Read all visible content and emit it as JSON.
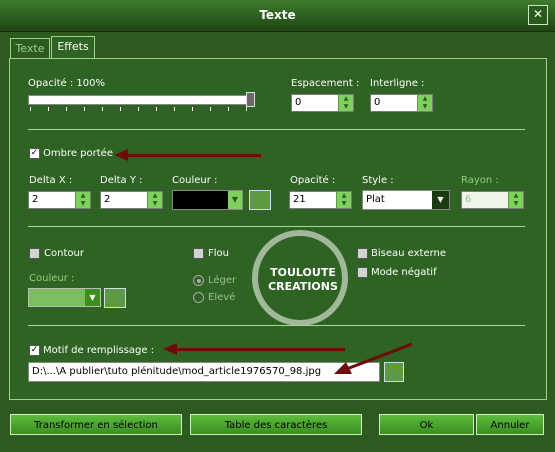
{
  "window": {
    "title": "Texte",
    "close_icon": "close-icon"
  },
  "tabs": [
    {
      "label": "Texte"
    },
    {
      "label": "Effets"
    }
  ],
  "opacity": {
    "label": "Opacité : 100%",
    "value_percent": 100
  },
  "espacement": {
    "label": "Espacement :",
    "value": "0"
  },
  "interligne": {
    "label": "Interligne :",
    "value": "0"
  },
  "ombre": {
    "label": "Ombre portée",
    "checked": true
  },
  "delta_x": {
    "label": "Delta X :",
    "value": "2"
  },
  "delta_y": {
    "label": "Delta Y :",
    "value": "2"
  },
  "couleur_ombre": {
    "label": "Couleur :",
    "value": "#000000"
  },
  "opacite2": {
    "label": "Opacité :",
    "value": "21"
  },
  "style": {
    "label": "Style :",
    "value": "Plat"
  },
  "rayon": {
    "label": "Rayon :",
    "value": "6"
  },
  "contour": {
    "label": "Contour",
    "checked": false
  },
  "flou": {
    "label": "Flou",
    "checked": false
  },
  "biseau": {
    "label": "Biseau externe",
    "checked": false
  },
  "mode_negatif": {
    "label": "Mode négatif",
    "checked": false
  },
  "couleur_contour": {
    "label": "Couleur :"
  },
  "leger": {
    "label": "Léger"
  },
  "eleve": {
    "label": "Elevé"
  },
  "watermark": {
    "line1": "TOULOUTE",
    "line2": "CREATIONS"
  },
  "motif": {
    "label": "Motif de remplissage :",
    "checked": true,
    "path": "D:\\...\\A publier\\tuto plénitude\\mod_article1976570_98.jpg"
  },
  "buttons": {
    "transform": "Transformer en sélection",
    "table": "Table des caractères",
    "ok": "Ok",
    "cancel": "Annuler"
  },
  "colors": {
    "accent": "#7fd05d",
    "arrow": "#6e0b0b"
  }
}
